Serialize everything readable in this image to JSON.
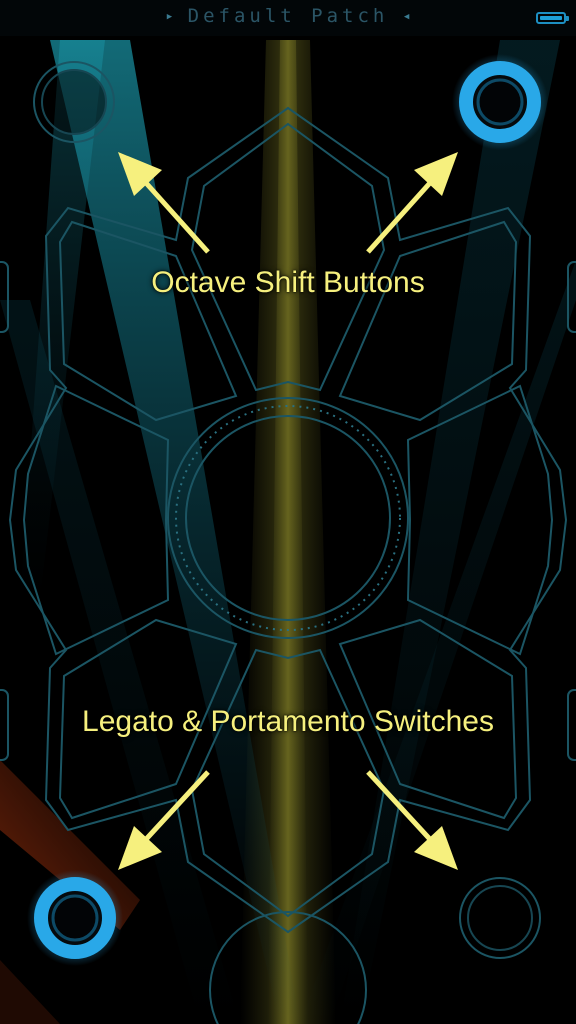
{
  "header": {
    "patch_name": "Default Patch",
    "left_marker": "▶",
    "right_marker": "◀",
    "battery_level": 1.0
  },
  "annotations": {
    "octave_label": "Octave Shift Buttons",
    "switches_label": "Legato & Portamento Switches"
  },
  "controls": {
    "octave_down": {
      "active": false
    },
    "octave_up": {
      "active": true
    },
    "legato": {
      "active": true
    },
    "portamento": {
      "active": false
    }
  },
  "colors": {
    "annotation_text": "#f6f07e",
    "arrow": "#f6f07e",
    "active_ring": "#29a8e8",
    "pad_outline": "#1b5563",
    "background": "#000000"
  }
}
